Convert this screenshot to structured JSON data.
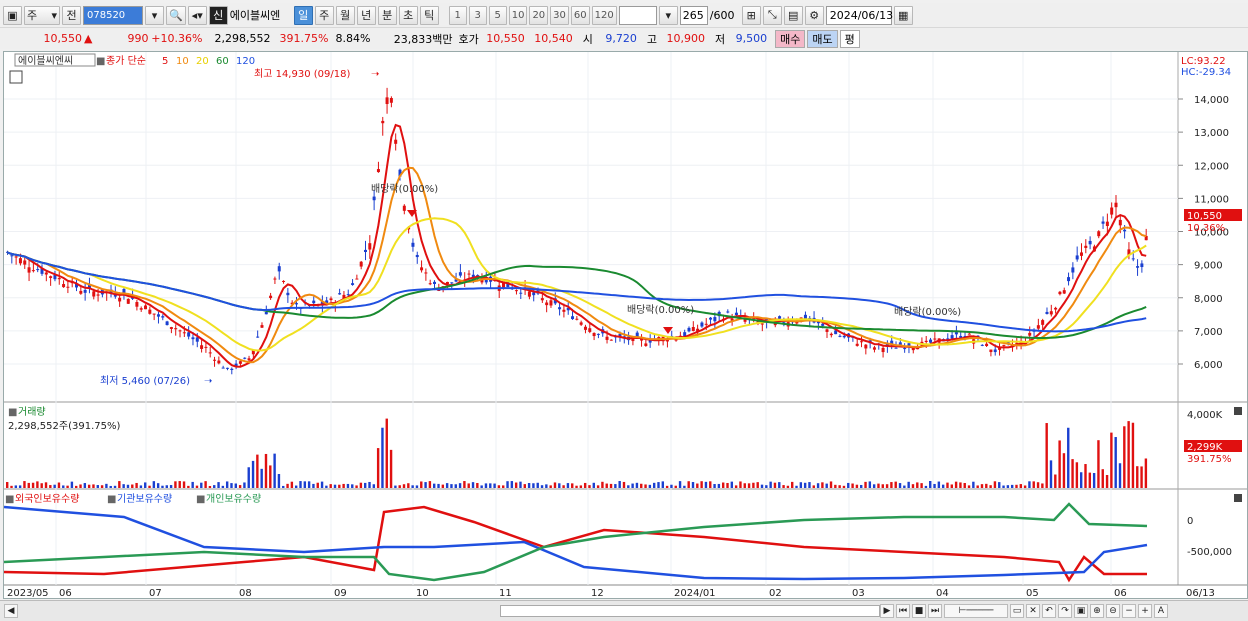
{
  "toolbar": {
    "period_select": "주",
    "prev_label": "전",
    "code": "078520",
    "shin_label": "신",
    "stock_name": "에이블씨엔",
    "intervals": [
      "일",
      "주",
      "월",
      "년",
      "분",
      "초",
      "틱"
    ],
    "active_interval": "일",
    "minute_options": [
      "1",
      "3",
      "5",
      "10",
      "20",
      "30",
      "60",
      "120"
    ],
    "count": "265",
    "count_total": "/600",
    "date": "2024/06/13"
  },
  "quote": {
    "price": "10,550",
    "change": "990",
    "change_pct": "+10.36%",
    "volume": "2,298,552",
    "volume_ratio": "391.75%",
    "turnover": "8.84%",
    "amount": "23,833백만",
    "hoga_label": "호가",
    "ask": "10,550",
    "bid": "10,540",
    "open_label": "시",
    "open": "9,720",
    "high_label": "고",
    "high": "10,900",
    "low_label": "저",
    "low": "9,500",
    "buy_btn": "매수",
    "sell_btn": "매도",
    "eval_btn": "평"
  },
  "price_panel": {
    "title": "에이블씨엔씨",
    "ma_label": "종가 단순",
    "ma_periods": [
      "5",
      "10",
      "20",
      "60",
      "120"
    ],
    "ma_colors": [
      "#e01010",
      "#f08a10",
      "#f0e020",
      "#1a8a30",
      "#2050e0"
    ],
    "lc": "LC:93.22",
    "hc": "HC:-29.34",
    "y_ticks": [
      "14,000",
      "13,000",
      "12,000",
      "11,000",
      "10,000",
      "9,000",
      "8,000",
      "7,000",
      "6,000"
    ],
    "last_price_tag": "10,550",
    "last_pct_tag": "10.36%",
    "high_annot": "최고 14,930 (09/18)",
    "low_annot": "최저 5,460 (07/26)",
    "dividend_annots": [
      "배당락(0.00%)",
      "배당락(0.00%)",
      "배당락(0.00%)"
    ]
  },
  "volume_panel": {
    "title": "거래량",
    "subtitle": "2,298,552주(391.75%)",
    "y_tick": "4,000K",
    "last_tag": "2,299K",
    "last_pct": "391.75%"
  },
  "holder_panel": {
    "legend": [
      "외국인보유수량",
      "기관보유수량",
      "개인보유수량"
    ],
    "colors": [
      "#e01010",
      "#2050e0",
      "#2a9a55"
    ],
    "y_ticks": [
      "0",
      "-500,000"
    ]
  },
  "x_axis": [
    "2023/05",
    "06",
    "07",
    "08",
    "09",
    "10",
    "11",
    "12",
    "2024/01",
    "02",
    "03",
    "04",
    "05",
    "06",
    "06/13"
  ]
}
